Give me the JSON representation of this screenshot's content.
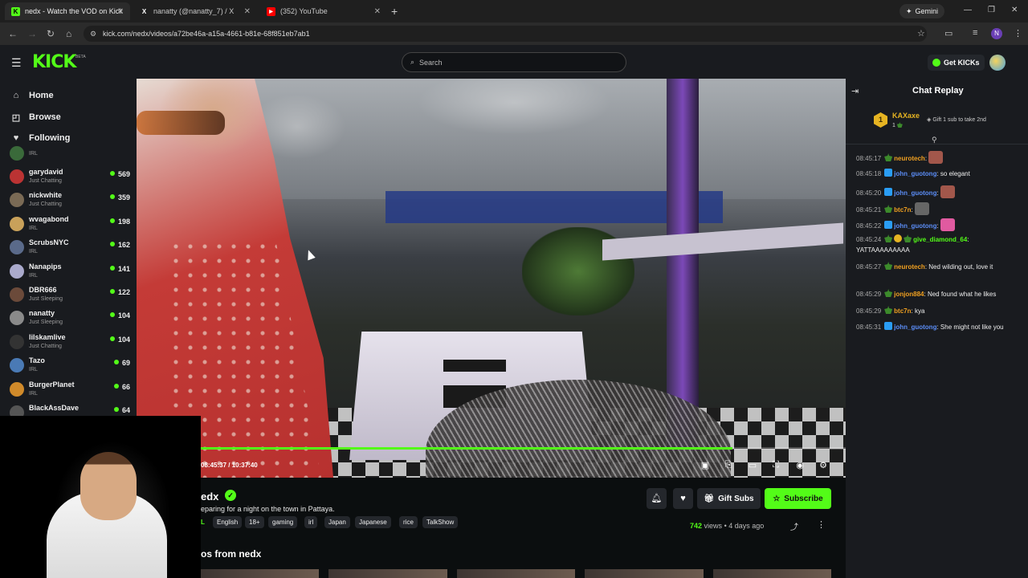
{
  "browser": {
    "tabs": [
      {
        "title": "nedx - Watch the VOD on Kick",
        "favicon": "K",
        "active": true
      },
      {
        "title": "nanatty (@nanatty_7) / X",
        "favicon": "X",
        "active": false
      },
      {
        "title": "(352) YouTube",
        "favicon": "▶",
        "active": false
      }
    ],
    "gemini_label": "Gemini",
    "url": "kick.com/nedx/videos/a72be46a-a15a-4661-b81e-68f851eb7ab1",
    "profile_initial": "N"
  },
  "header": {
    "logo": "KICK",
    "logo_badge": "BETA",
    "search_placeholder": "Search",
    "get_kicks_label": "Get KICKs"
  },
  "sidebar": {
    "nav": [
      {
        "label": "Home",
        "icon": "home-icon",
        "glyph": "⌂"
      },
      {
        "label": "Browse",
        "icon": "browse-icon",
        "glyph": "◰"
      },
      {
        "label": "Following",
        "icon": "heart-icon",
        "glyph": "♥"
      }
    ],
    "partial_top_category": "IRL",
    "channels": [
      {
        "name": "garydavid",
        "category": "Just Chatting",
        "viewers": "569",
        "color": "#b33"
      },
      {
        "name": "nickwhite",
        "category": "Just Chatting",
        "viewers": "359",
        "color": "#7a6a55"
      },
      {
        "name": "wvagabond",
        "category": "IRL",
        "viewers": "198",
        "color": "#c9a15a"
      },
      {
        "name": "ScrubsNYC",
        "category": "IRL",
        "viewers": "162",
        "color": "#5a6a8a"
      },
      {
        "name": "Nanapips",
        "category": "IRL",
        "viewers": "141",
        "color": "#aac"
      },
      {
        "name": "DBR666",
        "category": "Just Sleeping",
        "viewers": "122",
        "color": "#6b4a3a"
      },
      {
        "name": "nanatty",
        "category": "Just Sleeping",
        "viewers": "104",
        "color": "#8a8a8a"
      },
      {
        "name": "lilskamlive",
        "category": "Just Chatting",
        "viewers": "104",
        "color": "#333"
      },
      {
        "name": "Tazo",
        "category": "IRL",
        "viewers": "69",
        "color": "#4a7ab5"
      },
      {
        "name": "BurgerPlanet",
        "category": "IRL",
        "viewers": "66",
        "color": "#d08a2a"
      },
      {
        "name": "BlackAssDave",
        "category": "",
        "viewers": "64",
        "color": "#555"
      }
    ]
  },
  "player": {
    "timecode": "08:45:37 / 10:37:40",
    "progress": 0.824
  },
  "stream": {
    "channel_fragment": "edx",
    "title_fragment": "eparing for a night on the town in Pattaya.",
    "lang_fragment": "L",
    "tags": [
      "English",
      "18+",
      "gaming",
      "irl",
      "Japan",
      "Japanese",
      "rice",
      "TalkShow"
    ],
    "gift_subs_label": "Gift Subs",
    "subscribe_label": "Subscribe",
    "views_count": "742",
    "views_suffix": "views",
    "age": "4 days ago",
    "vods_heading_fragment": "os from nedx"
  },
  "chat": {
    "title": "Chat Replay",
    "top_gifter": {
      "rank": "1",
      "name": "KAXaxe",
      "count": "1"
    },
    "gift_cta": "Gift 1 sub to take 2nd",
    "messages": [
      {
        "time": "08:45:17",
        "user": "neurotech",
        "color": "#f0a020",
        "text": "",
        "emote": "#a2574b"
      },
      {
        "time": "08:45:18",
        "user": "john_guotong",
        "color": "#5b8df6",
        "text": "so elegant",
        "emote": ""
      },
      {
        "time": "08:45:20",
        "user": "john_guotong",
        "color": "#5b8df6",
        "text": "",
        "emote": "#a2574b"
      },
      {
        "time": "08:45:21",
        "user": "btc7n",
        "color": "#f0a020",
        "text": "",
        "emote": "#666"
      },
      {
        "time": "08:45:22",
        "user": "john_guotong",
        "color": "#5b8df6",
        "text": "",
        "emote": "#e05aa0"
      },
      {
        "time": "08:45:24",
        "user": "give_diamond_64",
        "color": "#53fc18",
        "text": "YATTAAAAAAAAA",
        "emote": ""
      },
      {
        "time": "08:45:27",
        "user": "neurotech",
        "color": "#f0a020",
        "text": "Ned wilding out, love it",
        "emote": ""
      },
      {
        "time": "08:45:29",
        "user": "jonjon884",
        "color": "#f0a020",
        "text": "Ned found what he likes",
        "emote": ""
      },
      {
        "time": "08:45:29",
        "user": "btc7n",
        "color": "#f0a020",
        "text": "kya",
        "emote": ""
      },
      {
        "time": "08:45:31",
        "user": "john_guotong",
        "color": "#5b8df6",
        "text": "She might not like you",
        "emote": ""
      }
    ]
  }
}
